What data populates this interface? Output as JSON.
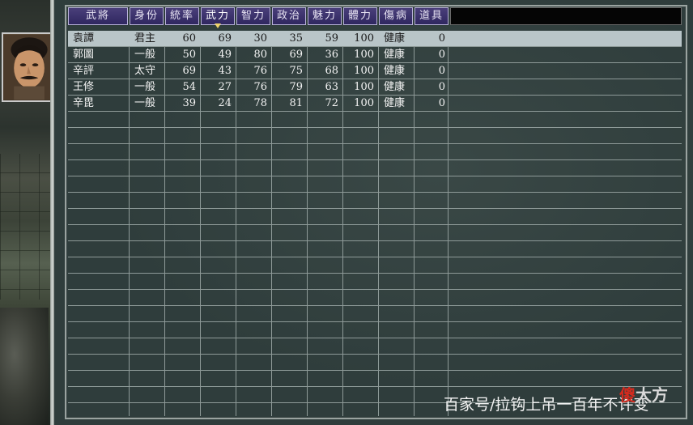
{
  "columns": [
    {
      "label": "武將",
      "width": 74
    },
    {
      "label": "身份",
      "width": 42
    },
    {
      "label": "統率",
      "width": 42
    },
    {
      "label": "武力",
      "width": 42,
      "active": true
    },
    {
      "label": "智力",
      "width": 42
    },
    {
      "label": "政治",
      "width": 42
    },
    {
      "label": "魅力",
      "width": 42
    },
    {
      "label": "體力",
      "width": 42
    },
    {
      "label": "傷病",
      "width": 42
    },
    {
      "label": "道具",
      "width": 42
    }
  ],
  "rows": [
    {
      "name": "袁譚",
      "rank": "君主",
      "leadership": "60",
      "war": "69",
      "intelligence": "30",
      "politics": "35",
      "charisma": "59",
      "stamina": "100",
      "health": "健康",
      "items": "0",
      "selected": true
    },
    {
      "name": "郭圖",
      "rank": "一般",
      "leadership": "50",
      "war": "49",
      "intelligence": "80",
      "politics": "69",
      "charisma": "36",
      "stamina": "100",
      "health": "健康",
      "items": "0"
    },
    {
      "name": "辛評",
      "rank": "太守",
      "leadership": "69",
      "war": "43",
      "intelligence": "76",
      "politics": "75",
      "charisma": "68",
      "stamina": "100",
      "health": "健康",
      "items": "0"
    },
    {
      "name": "王修",
      "rank": "一般",
      "leadership": "54",
      "war": "27",
      "intelligence": "76",
      "politics": "79",
      "charisma": "63",
      "stamina": "100",
      "health": "健康",
      "items": "0"
    },
    {
      "name": "辛毘",
      "rank": "一般",
      "leadership": "39",
      "war": "24",
      "intelligence": "78",
      "politics": "81",
      "charisma": "72",
      "stamina": "100",
      "health": "健康",
      "items": "0"
    }
  ],
  "watermark": "百家号/拉钩上吊一百年不许变",
  "logo": {
    "part1": "傻",
    "part2": "大方"
  },
  "colors": {
    "header_bg": "#2f2760",
    "panel_bg": "#2f3d3c",
    "grid_line": "#8e9a98",
    "selected_row": "#b9c5c8",
    "sort_marker": "#f0d46a"
  }
}
